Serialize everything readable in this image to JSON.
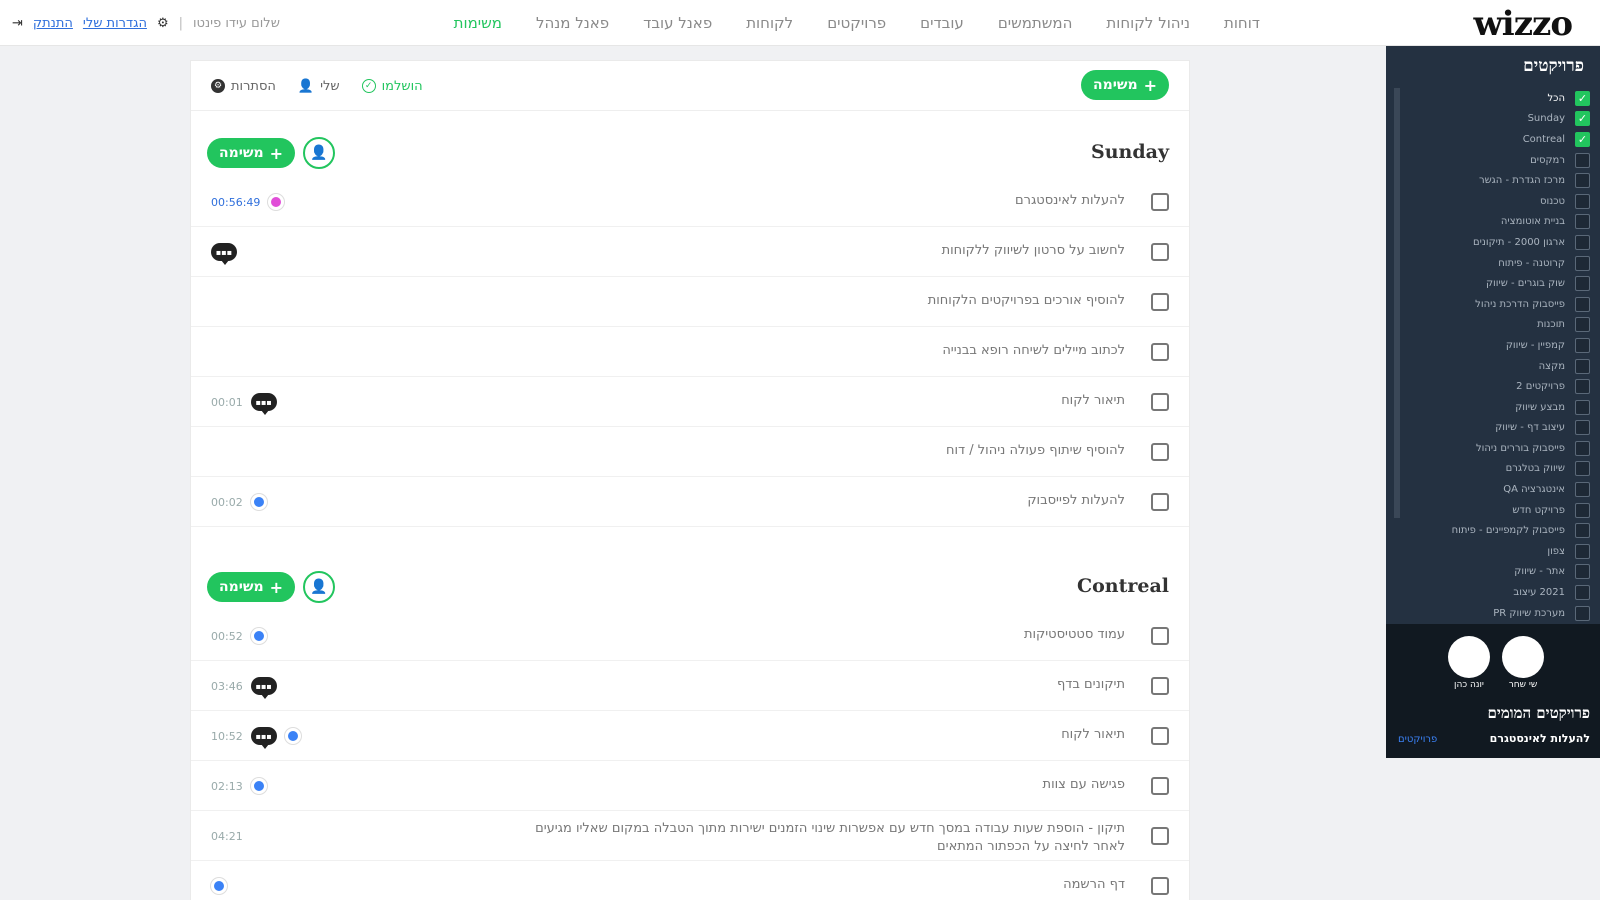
{
  "nav": {
    "logo": "wizzo",
    "items": [
      "משימות",
      "פאנל מנהל",
      "פאנל עובד",
      "לקוחות",
      "פרויקטים",
      "עובדים",
      "המשתמשים",
      "ניהול לקוחות",
      "דוחות"
    ],
    "active_index": 0
  },
  "user": {
    "greeting": "שלום עידו פינטו",
    "settings_label": "הגדרות שלי",
    "logout_label": "התנתק"
  },
  "toolbar": {
    "add_label": "משימה",
    "filters": [
      {
        "label": "הושלמו",
        "icon": "check-circle-icon"
      },
      {
        "label": "שלי",
        "icon": "user-icon"
      },
      {
        "label": "הסתרות",
        "icon": "gear-icon"
      }
    ]
  },
  "sections": [
    {
      "title": "Sunday",
      "add_label": "משימה",
      "rows": [
        {
          "text": "להעלות לאינסטגרם",
          "time": "00:56:49",
          "chat": false,
          "dot": "pink"
        },
        {
          "text": "לחשוב על סרטון לשיווק ללקוחות",
          "time": "",
          "chat": true,
          "dot": ""
        },
        {
          "text": "להוסיף אורכים בפרויקטים הלקוחות",
          "time": "",
          "chat": false,
          "dot": ""
        },
        {
          "text": "לכתוב מיילים לשיחה רופא בבנייה",
          "time": "",
          "chat": false,
          "dot": ""
        },
        {
          "text": "תיאור לקוח",
          "time": "00:01",
          "chat": true,
          "dot": ""
        },
        {
          "text": "להוסיף שיתוף פעולה ניהול / דוח",
          "time": "",
          "chat": false,
          "dot": ""
        },
        {
          "text": "להעלות לפייסבוק",
          "time": "00:02",
          "chat": false,
          "dot": "blue"
        }
      ]
    },
    {
      "title": "Contreal",
      "add_label": "משימה",
      "rows": [
        {
          "text": "עמוד סטטיסטיקות",
          "time": "00:52",
          "chat": false,
          "dot": "blue"
        },
        {
          "text": "תיקונים בדף",
          "time": "03:46",
          "chat": true,
          "dot": ""
        },
        {
          "text": "תיאור לקוח",
          "time": "10:52",
          "chat": true,
          "dot": "blue"
        },
        {
          "text": "פגישה עם צוות",
          "time": "02:13",
          "chat": false,
          "dot": "blue"
        },
        {
          "text": "תיקון - הוספת שעות עבודה במסך חדש עם אפשרות שינוי הזמנים ישירות מתוך הטבלה במקום שאליו מגיעים לאחר לחיצה על הכפתור המתאים",
          "time": "04:21",
          "chat": false,
          "dot": "",
          "multi": true
        },
        {
          "text": "דף הרשמה",
          "time": "",
          "chat": false,
          "dot": "blue"
        }
      ]
    }
  ],
  "sidebar": {
    "title": "פרויקטים",
    "items": [
      {
        "label": "הכל",
        "checked": true
      },
      {
        "label": "Sunday",
        "checked": true
      },
      {
        "label": "Contreal",
        "checked": true
      },
      {
        "label": "רמקסים",
        "checked": false
      },
      {
        "label": "מרכז הגדרת - הגשר",
        "checked": false
      },
      {
        "label": "טכנוס",
        "checked": false
      },
      {
        "label": "בניית אוטומציה",
        "checked": false
      },
      {
        "label": "ארגון 2000 - תיקונים",
        "checked": false
      },
      {
        "label": "קרוטנה - פיתוח",
        "checked": false
      },
      {
        "label": "שוק בוגרים - שיווק",
        "checked": false
      },
      {
        "label": "פייסבוק הדרכת ניהול",
        "checked": false
      },
      {
        "label": "תוכנות",
        "checked": false
      },
      {
        "label": "קמפיין - שיווק",
        "checked": false
      },
      {
        "label": "מקצה",
        "checked": false
      },
      {
        "label": "פרויקטים 2",
        "checked": false
      },
      {
        "label": "מבצע שיווק",
        "checked": false
      },
      {
        "label": "עיצוב דף - שיווק",
        "checked": false
      },
      {
        "label": "פייסבוק בוררים ניהול",
        "checked": false
      },
      {
        "label": "שיווק בטלגרם",
        "checked": false
      },
      {
        "label": "אינטגרציה QA",
        "checked": false
      },
      {
        "label": "פרויקט חדש",
        "checked": false
      },
      {
        "label": "פייסבוק לקמפיינים - פיתוח",
        "checked": false
      },
      {
        "label": "צפון",
        "checked": false
      },
      {
        "label": "אתר - שיווק",
        "checked": false
      },
      {
        "label": "2021 עיצוב",
        "checked": false
      },
      {
        "label": "מערכת שיווק PR",
        "checked": false
      }
    ],
    "team": [
      {
        "name": "שי שחר"
      },
      {
        "name": "יונה כהן"
      }
    ],
    "bottom_title": "פרויקטים המומים",
    "bottom_sub": "להעלות לאינסטגרם",
    "bottom_link": "פרויקטים"
  }
}
